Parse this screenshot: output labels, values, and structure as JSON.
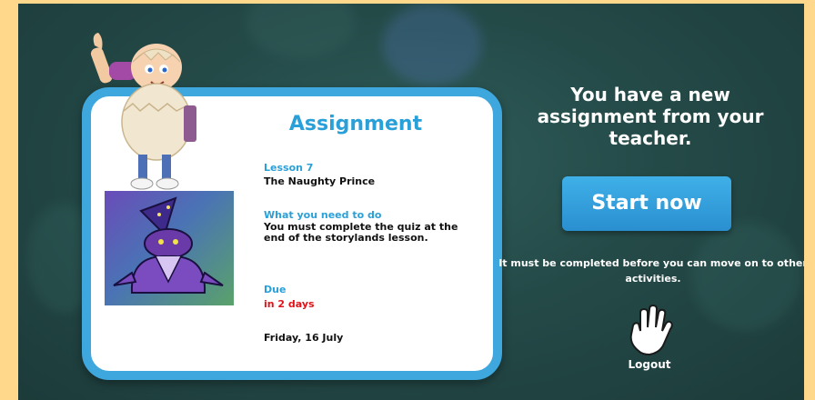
{
  "card": {
    "title": "Assignment",
    "lesson_label": "Lesson 7",
    "lesson_value": "The Naughty Prince",
    "todo_label": "What you need to do",
    "todo_value": "You must complete the quiz at the end of the storylands lesson.",
    "due_label": "Due",
    "due_relative": "in 2 days",
    "due_date": "Friday, 16 July"
  },
  "message": {
    "title": "You have a new assignment from your teacher.",
    "start_button": "Start now",
    "note": "It must be completed before you can move on to other activities.",
    "logout_label": "Logout"
  },
  "icons": [
    "hand-icon"
  ],
  "colors": {
    "accent": "#2aa0d8",
    "due_red": "#e0141b",
    "background": "#244a48",
    "frame": "#ffd88c"
  }
}
